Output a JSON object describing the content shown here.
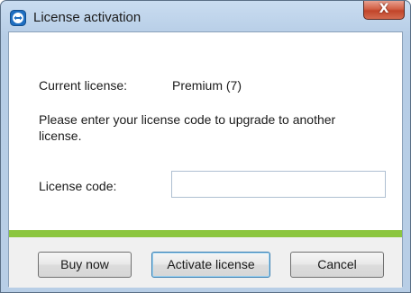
{
  "window": {
    "title": "License activation",
    "close_glyph": "X",
    "icon": "teamviewer-app-icon"
  },
  "content": {
    "current_license_label": "Current license:",
    "current_license_value": "Premium (7)",
    "instruction": "Please enter your license code to upgrade to another license.",
    "license_code_label": "License code:",
    "license_code_value": "",
    "license_code_placeholder": ""
  },
  "buttons": {
    "buy_now": "Buy now",
    "activate": "Activate license",
    "cancel": "Cancel"
  },
  "colors": {
    "accent_bar": "#8cc63f",
    "title_gradient_top": "#c9dcf0",
    "close_button": "#c1452a"
  }
}
